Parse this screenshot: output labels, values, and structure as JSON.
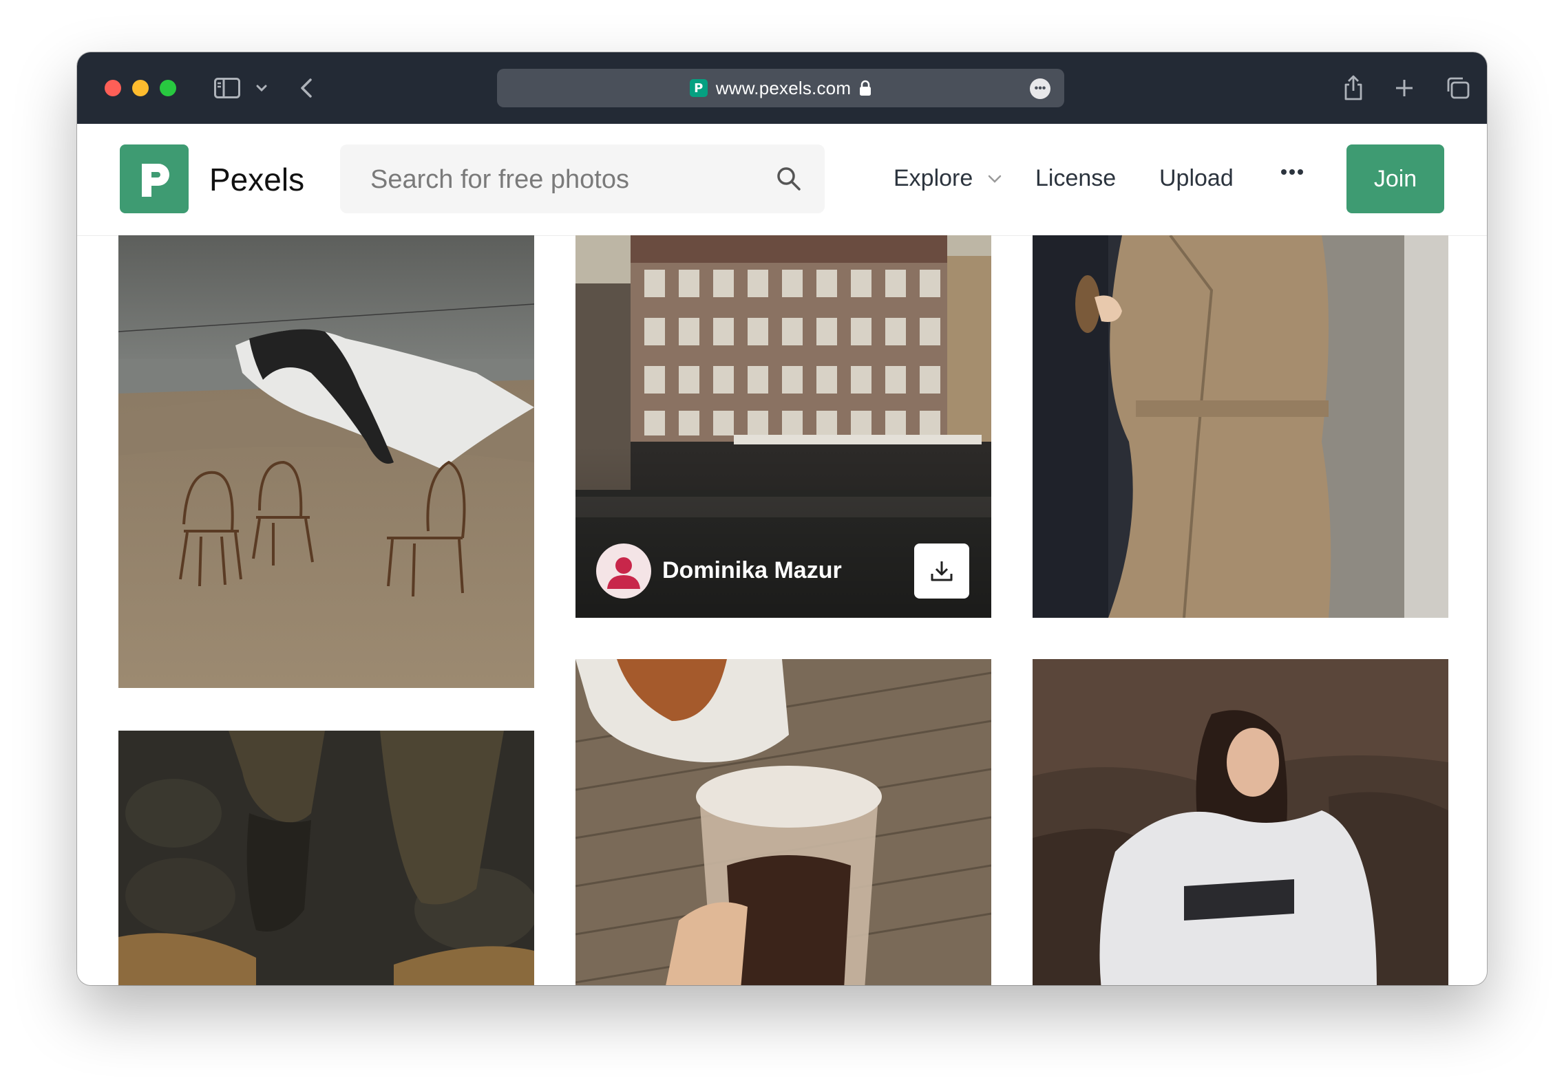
{
  "browser": {
    "url": "www.pexels.com",
    "favicon_letter": "P",
    "colors": {
      "chrome": "#232a35",
      "address_bar": "#4a505a"
    }
  },
  "header": {
    "logo_text": "Pexels",
    "search_placeholder": "Search for free photos",
    "nav": {
      "explore": "Explore",
      "license": "License",
      "upload": "Upload"
    },
    "join_label": "Join",
    "colors": {
      "brand": "#3e9b72"
    }
  },
  "grid": {
    "photos": [
      {
        "subject": "chairs-on-beach"
      },
      {
        "subject": "building-street",
        "photographer": "Dominika Mazur"
      },
      {
        "subject": "trench-coat-door"
      },
      {
        "subject": "boots-on-rocks"
      },
      {
        "subject": "iced-drink-hello-bag"
      },
      {
        "subject": "girl-sweatshirt-rocks"
      }
    ]
  }
}
